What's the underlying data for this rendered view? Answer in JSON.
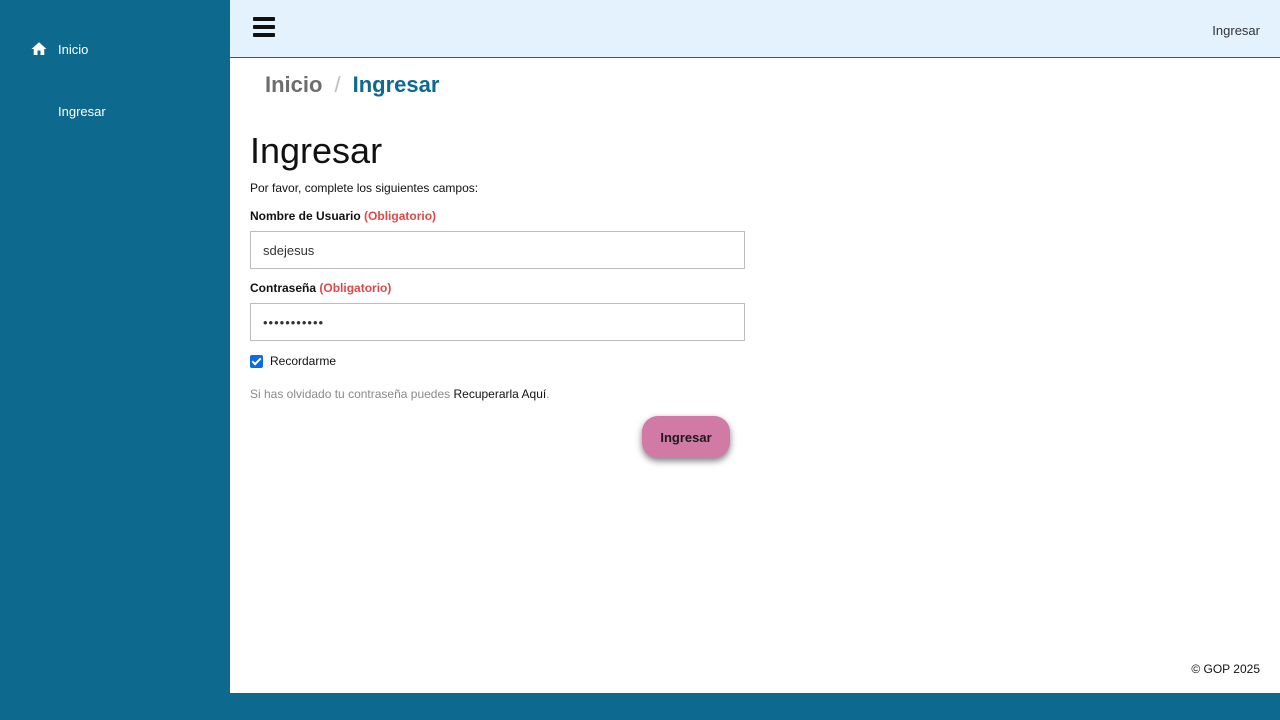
{
  "sidebar": {
    "items": [
      {
        "label": "Inicio",
        "icon": "home-icon"
      },
      {
        "label": "Ingresar"
      }
    ]
  },
  "topbar": {
    "menu_icon": "hamburger-icon",
    "link": "Ingresar"
  },
  "breadcrumb": {
    "home": "Inicio",
    "separator": "/",
    "current": "Ingresar"
  },
  "form": {
    "title": "Ingresar",
    "intro": "Por favor, complete los siguientes campos:",
    "required_tag": "(Obligatorio)",
    "username": {
      "label": "Nombre de Usuario",
      "value": "sdejesus"
    },
    "password": {
      "label": "Contraseña",
      "value": "•••••••••••"
    },
    "remember": {
      "label": "Recordarme",
      "checked": true
    },
    "recover_text": "Si has olvidado tu contraseña puedes",
    "recover_link": "Recuperarla Aquí",
    "recover_period": ".",
    "submit": "Ingresar"
  },
  "footer": {
    "text": "© GOP 2025"
  },
  "colors": {
    "brand": "#0d6a8e",
    "topbar": "#e3f2fd",
    "required": "#e04848",
    "button": "#d17aa6"
  }
}
